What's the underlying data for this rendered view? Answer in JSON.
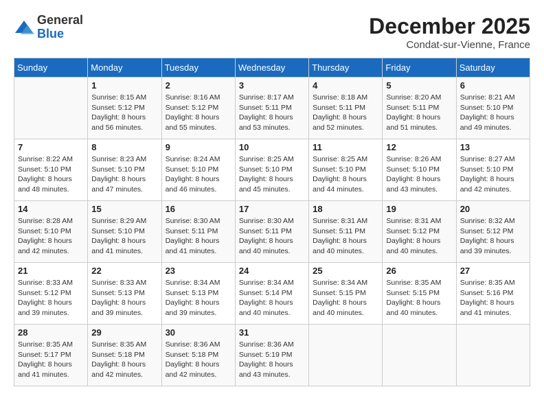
{
  "header": {
    "logo_general": "General",
    "logo_blue": "Blue",
    "month_year": "December 2025",
    "location": "Condat-sur-Vienne, France"
  },
  "days_of_week": [
    "Sunday",
    "Monday",
    "Tuesday",
    "Wednesday",
    "Thursday",
    "Friday",
    "Saturday"
  ],
  "weeks": [
    [
      {
        "num": "",
        "info": ""
      },
      {
        "num": "1",
        "info": "Sunrise: 8:15 AM\nSunset: 5:12 PM\nDaylight: 8 hours\nand 56 minutes."
      },
      {
        "num": "2",
        "info": "Sunrise: 8:16 AM\nSunset: 5:12 PM\nDaylight: 8 hours\nand 55 minutes."
      },
      {
        "num": "3",
        "info": "Sunrise: 8:17 AM\nSunset: 5:11 PM\nDaylight: 8 hours\nand 53 minutes."
      },
      {
        "num": "4",
        "info": "Sunrise: 8:18 AM\nSunset: 5:11 PM\nDaylight: 8 hours\nand 52 minutes."
      },
      {
        "num": "5",
        "info": "Sunrise: 8:20 AM\nSunset: 5:11 PM\nDaylight: 8 hours\nand 51 minutes."
      },
      {
        "num": "6",
        "info": "Sunrise: 8:21 AM\nSunset: 5:10 PM\nDaylight: 8 hours\nand 49 minutes."
      }
    ],
    [
      {
        "num": "7",
        "info": "Sunrise: 8:22 AM\nSunset: 5:10 PM\nDaylight: 8 hours\nand 48 minutes."
      },
      {
        "num": "8",
        "info": "Sunrise: 8:23 AM\nSunset: 5:10 PM\nDaylight: 8 hours\nand 47 minutes."
      },
      {
        "num": "9",
        "info": "Sunrise: 8:24 AM\nSunset: 5:10 PM\nDaylight: 8 hours\nand 46 minutes."
      },
      {
        "num": "10",
        "info": "Sunrise: 8:25 AM\nSunset: 5:10 PM\nDaylight: 8 hours\nand 45 minutes."
      },
      {
        "num": "11",
        "info": "Sunrise: 8:25 AM\nSunset: 5:10 PM\nDaylight: 8 hours\nand 44 minutes."
      },
      {
        "num": "12",
        "info": "Sunrise: 8:26 AM\nSunset: 5:10 PM\nDaylight: 8 hours\nand 43 minutes."
      },
      {
        "num": "13",
        "info": "Sunrise: 8:27 AM\nSunset: 5:10 PM\nDaylight: 8 hours\nand 42 minutes."
      }
    ],
    [
      {
        "num": "14",
        "info": "Sunrise: 8:28 AM\nSunset: 5:10 PM\nDaylight: 8 hours\nand 42 minutes."
      },
      {
        "num": "15",
        "info": "Sunrise: 8:29 AM\nSunset: 5:10 PM\nDaylight: 8 hours\nand 41 minutes."
      },
      {
        "num": "16",
        "info": "Sunrise: 8:30 AM\nSunset: 5:11 PM\nDaylight: 8 hours\nand 41 minutes."
      },
      {
        "num": "17",
        "info": "Sunrise: 8:30 AM\nSunset: 5:11 PM\nDaylight: 8 hours\nand 40 minutes."
      },
      {
        "num": "18",
        "info": "Sunrise: 8:31 AM\nSunset: 5:11 PM\nDaylight: 8 hours\nand 40 minutes."
      },
      {
        "num": "19",
        "info": "Sunrise: 8:31 AM\nSunset: 5:12 PM\nDaylight: 8 hours\nand 40 minutes."
      },
      {
        "num": "20",
        "info": "Sunrise: 8:32 AM\nSunset: 5:12 PM\nDaylight: 8 hours\nand 39 minutes."
      }
    ],
    [
      {
        "num": "21",
        "info": "Sunrise: 8:33 AM\nSunset: 5:12 PM\nDaylight: 8 hours\nand 39 minutes."
      },
      {
        "num": "22",
        "info": "Sunrise: 8:33 AM\nSunset: 5:13 PM\nDaylight: 8 hours\nand 39 minutes."
      },
      {
        "num": "23",
        "info": "Sunrise: 8:34 AM\nSunset: 5:13 PM\nDaylight: 8 hours\nand 39 minutes."
      },
      {
        "num": "24",
        "info": "Sunrise: 8:34 AM\nSunset: 5:14 PM\nDaylight: 8 hours\nand 40 minutes."
      },
      {
        "num": "25",
        "info": "Sunrise: 8:34 AM\nSunset: 5:15 PM\nDaylight: 8 hours\nand 40 minutes."
      },
      {
        "num": "26",
        "info": "Sunrise: 8:35 AM\nSunset: 5:15 PM\nDaylight: 8 hours\nand 40 minutes."
      },
      {
        "num": "27",
        "info": "Sunrise: 8:35 AM\nSunset: 5:16 PM\nDaylight: 8 hours\nand 41 minutes."
      }
    ],
    [
      {
        "num": "28",
        "info": "Sunrise: 8:35 AM\nSunset: 5:17 PM\nDaylight: 8 hours\nand 41 minutes."
      },
      {
        "num": "29",
        "info": "Sunrise: 8:35 AM\nSunset: 5:18 PM\nDaylight: 8 hours\nand 42 minutes."
      },
      {
        "num": "30",
        "info": "Sunrise: 8:36 AM\nSunset: 5:18 PM\nDaylight: 8 hours\nand 42 minutes."
      },
      {
        "num": "31",
        "info": "Sunrise: 8:36 AM\nSunset: 5:19 PM\nDaylight: 8 hours\nand 43 minutes."
      },
      {
        "num": "",
        "info": ""
      },
      {
        "num": "",
        "info": ""
      },
      {
        "num": "",
        "info": ""
      }
    ]
  ]
}
